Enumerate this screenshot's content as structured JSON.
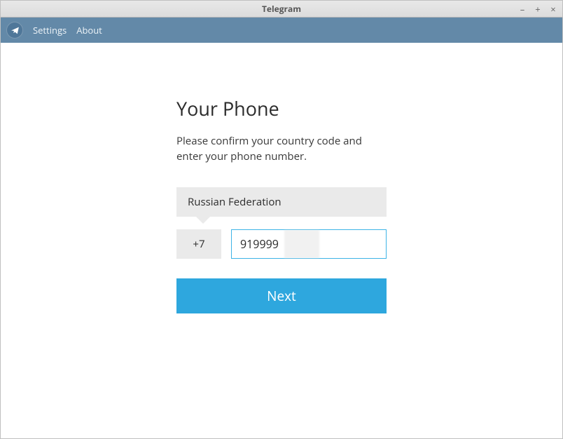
{
  "window": {
    "title": "Telegram"
  },
  "menubar": {
    "settings": "Settings",
    "about": "About"
  },
  "form": {
    "heading": "Your Phone",
    "subtext": "Please confirm your country code and enter your phone number.",
    "country": "Russian Federation",
    "country_code": "+7",
    "phone_value": "919999",
    "next_label": "Next"
  }
}
